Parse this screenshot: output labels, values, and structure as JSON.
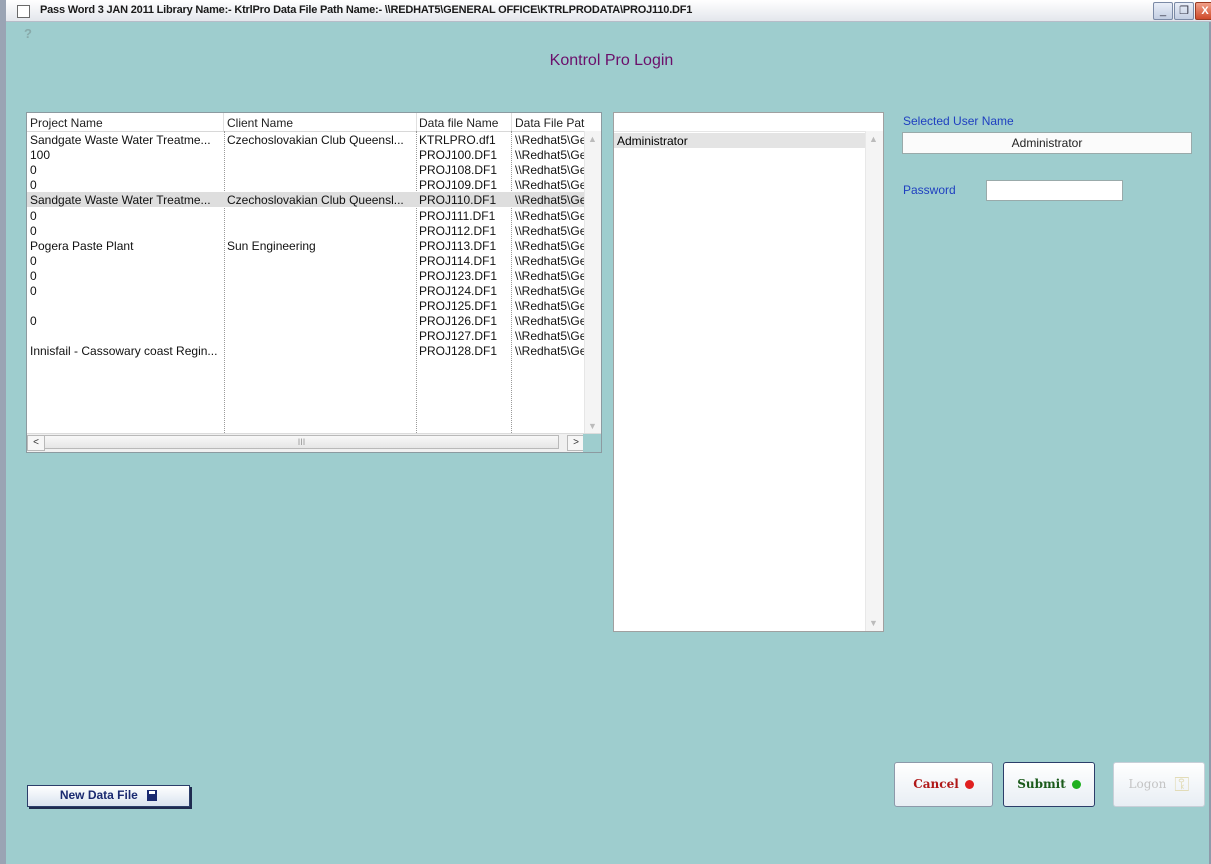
{
  "window": {
    "title": "Pass Word  3 JAN 2011  Library Name:- KtrlPro  Data File Path Name:- \\\\REDHAT5\\GENERAL OFFICE\\KTRLPRODATA\\PROJ110.DF1",
    "minimize": "_",
    "restore": "❐",
    "close": "X"
  },
  "help_icon": "?",
  "heading": "Kontrol Pro Login",
  "projects": {
    "columns": [
      "Project Name",
      "Client Name",
      "Data file Name",
      "Data File Pathn"
    ],
    "rows": [
      {
        "project": "Sandgate Waste Water Treatme...",
        "client": "Czechoslovakian Club Queensl...",
        "file": "KTRLPRO.df1",
        "path": "\\\\Redhat5\\Ge"
      },
      {
        "project": "100",
        "client": "",
        "file": "PROJ100.DF1",
        "path": "\\\\Redhat5\\Ge"
      },
      {
        "project": "0",
        "client": "",
        "file": "PROJ108.DF1",
        "path": "\\\\Redhat5\\Ge"
      },
      {
        "project": "0",
        "client": "",
        "file": "PROJ109.DF1",
        "path": "\\\\Redhat5\\Ge"
      },
      {
        "project": "Sandgate Waste Water Treatme...",
        "client": "Czechoslovakian Club Queensl...",
        "file": "PROJ110.DF1",
        "path": "\\\\Redhat5\\Ge",
        "selected": true
      },
      {
        "project": "0",
        "client": "",
        "file": "PROJ111.DF1",
        "path": "\\\\Redhat5\\Ge"
      },
      {
        "project": "0",
        "client": "",
        "file": "PROJ112.DF1",
        "path": "\\\\Redhat5\\Ge"
      },
      {
        "project": "Pogera Paste Plant",
        "client": "Sun Engineering",
        "file": "PROJ113.DF1",
        "path": "\\\\Redhat5\\Ge"
      },
      {
        "project": "0",
        "client": "",
        "file": "PROJ114.DF1",
        "path": "\\\\Redhat5\\Ge"
      },
      {
        "project": "0",
        "client": "",
        "file": "PROJ123.DF1",
        "path": "\\\\Redhat5\\Ge"
      },
      {
        "project": "0",
        "client": "",
        "file": "PROJ124.DF1",
        "path": "\\\\Redhat5\\Ge"
      },
      {
        "project": "",
        "client": "",
        "file": "PROJ125.DF1",
        "path": "\\\\Redhat5\\Ge"
      },
      {
        "project": "0",
        "client": "",
        "file": "PROJ126.DF1",
        "path": "\\\\Redhat5\\Ge"
      },
      {
        "project": "",
        "client": "",
        "file": "PROJ127.DF1",
        "path": "\\\\Redhat5\\Ge"
      },
      {
        "project": "Innisfail - Cassowary coast Regin...",
        "client": "",
        "file": "PROJ128.DF1",
        "path": "\\\\Redhat5\\Ge"
      }
    ],
    "scroll_left": "<",
    "scroll_right": ">",
    "scroll_grip": "III"
  },
  "users": {
    "items": [
      "Administrator"
    ]
  },
  "selected_user": {
    "label": "Selected User Name",
    "value": "Administrator"
  },
  "password": {
    "label": "Password",
    "value": ""
  },
  "buttons": {
    "cancel": "Cancel",
    "submit": "Submit",
    "logon": "Logon",
    "new_data_file": "New Data File"
  },
  "colors": {
    "background": "#9ecdce",
    "heading": "#6b0f6b",
    "label_blue": "#1f3fc0",
    "cancel_dot": "#e02020",
    "submit_dot": "#20b020"
  }
}
